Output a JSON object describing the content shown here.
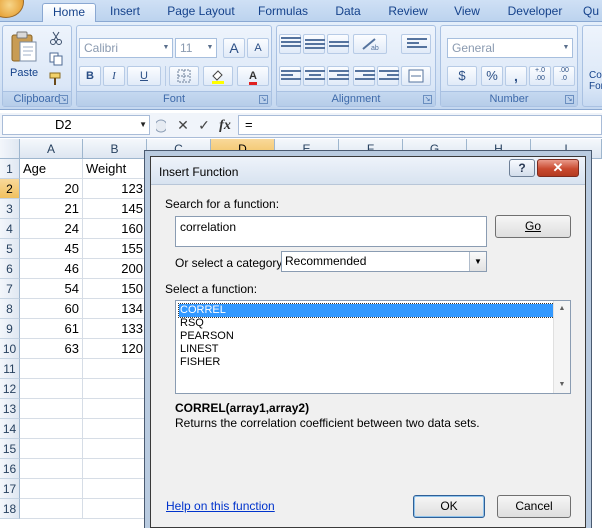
{
  "ribbon": {
    "tabs": [
      {
        "label": "Home",
        "active": true
      },
      {
        "label": "Insert"
      },
      {
        "label": "Page Layout"
      },
      {
        "label": "Formulas"
      },
      {
        "label": "Data"
      },
      {
        "label": "Review"
      },
      {
        "label": "View"
      },
      {
        "label": "Developer"
      },
      {
        "label": "Qu"
      }
    ],
    "clipboard": {
      "label": "Clipboard",
      "paste_label": "Paste"
    },
    "font": {
      "label": "Font",
      "font_name": "Calibri",
      "font_size": "11",
      "bold": "B",
      "italic": "I",
      "underline": "U",
      "grow": "A",
      "shrink": "A",
      "color_letter": "A"
    },
    "alignment": {
      "label": "Alignment"
    },
    "number": {
      "label": "Number",
      "format": "General",
      "currency": "$",
      "percent": "%",
      "comma": ",",
      "inc_decimal": "+.0\n.00",
      "dec_decimal": ".00\n.0"
    },
    "styles_partial": {
      "line1": "Co",
      "line2": "For"
    }
  },
  "formula_bar": {
    "name_box": "D2",
    "cancel": "✕",
    "enter": "✓",
    "fx": "fx",
    "formula": "="
  },
  "sheet": {
    "columns": [
      "A",
      "B",
      "C",
      "D",
      "E",
      "F",
      "G",
      "H",
      "I"
    ],
    "selected_column": "D",
    "rows": [
      "1",
      "2",
      "3",
      "4",
      "5",
      "6",
      "7",
      "8",
      "9",
      "10",
      "11",
      "12",
      "13",
      "14",
      "15",
      "16",
      "17",
      "18"
    ],
    "selected_row": "2",
    "header_row": [
      "Age",
      "Weight"
    ],
    "data": [
      [
        "20",
        "123"
      ],
      [
        "21",
        "145"
      ],
      [
        "24",
        "160"
      ],
      [
        "45",
        "155"
      ],
      [
        "46",
        "200"
      ],
      [
        "54",
        "150"
      ],
      [
        "60",
        "134"
      ],
      [
        "61",
        "133"
      ],
      [
        "63",
        "120"
      ]
    ]
  },
  "dialog": {
    "title": "Insert Function",
    "help": "?",
    "close": "✕",
    "search_label": "Search for a function:",
    "search_value": "correlation",
    "go": "Go",
    "category_label": "Or select a category:",
    "category_value": "Recommended",
    "select_label": "Select a function:",
    "functions": [
      "CORREL",
      "RSQ",
      "PEARSON",
      "LINEST",
      "FISHER"
    ],
    "selected_function": "CORREL",
    "syntax": "CORREL(array1,array2)",
    "description": "Returns the correlation coefficient between two data sets.",
    "help_link": "Help on this function",
    "ok": "OK",
    "cancel": "Cancel"
  }
}
